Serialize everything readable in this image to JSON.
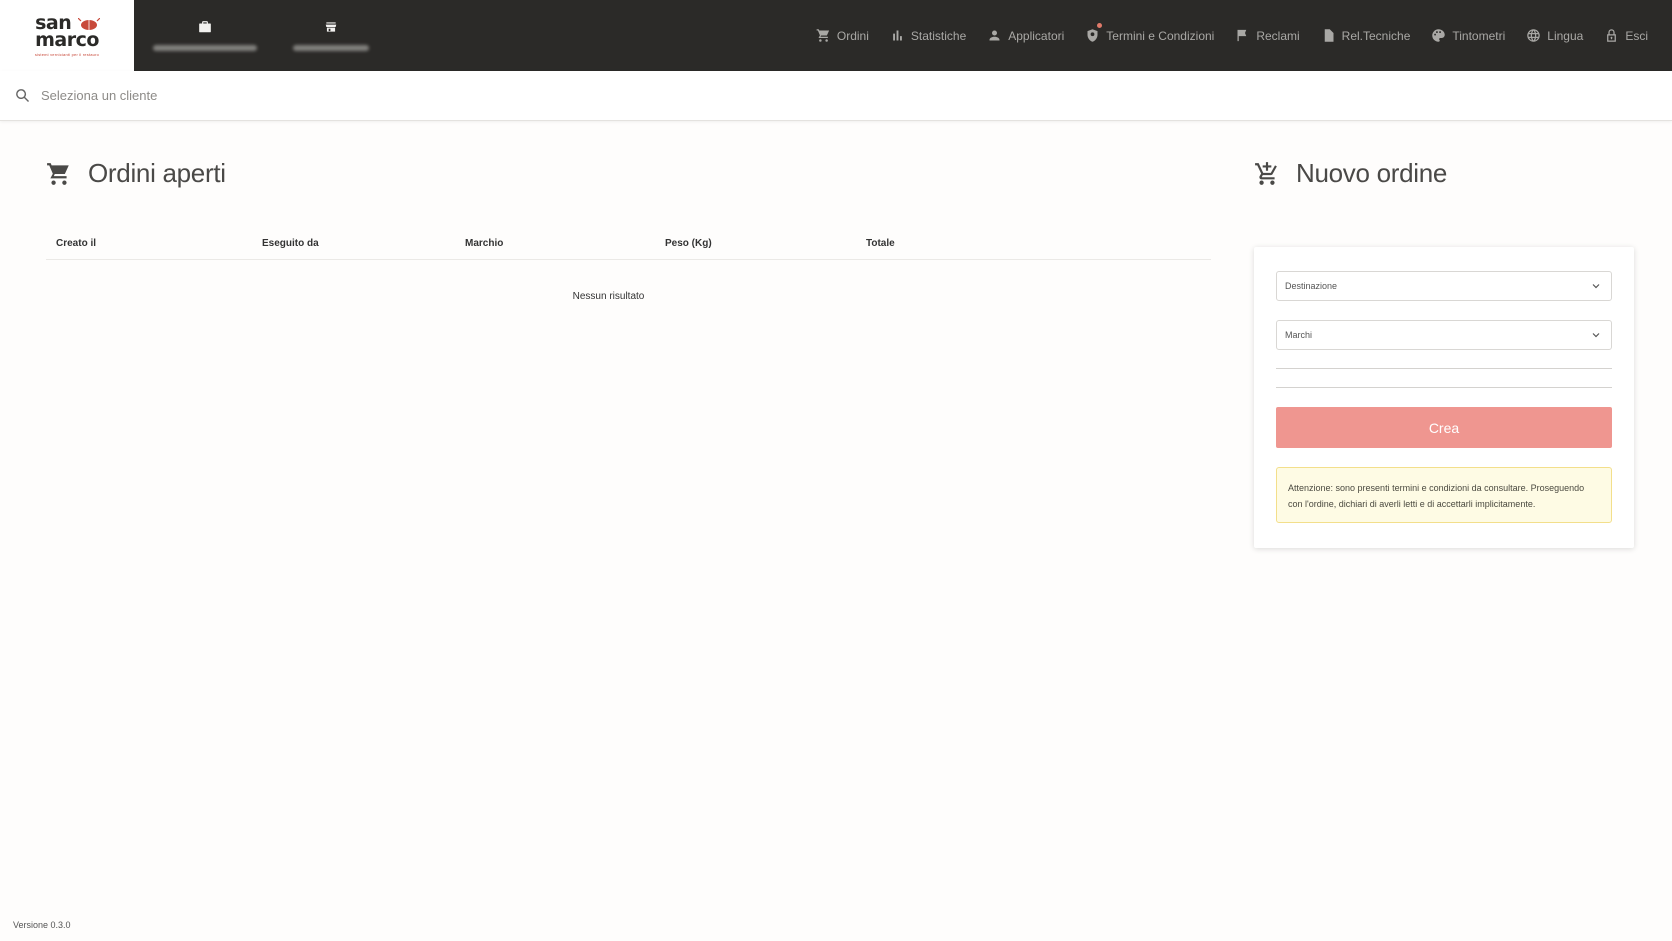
{
  "brand": {
    "line1": "san",
    "line2": "marco",
    "tagline": "sistemi vernicianti per il restauro"
  },
  "topnav": {
    "left": [
      {
        "icon": "briefcase-icon"
      },
      {
        "icon": "store-icon"
      }
    ],
    "right": [
      {
        "icon": "cart-icon",
        "label": "Ordini"
      },
      {
        "icon": "bar-chart-icon",
        "label": "Statistiche"
      },
      {
        "icon": "person-icon",
        "label": "Applicatori"
      },
      {
        "icon": "terms-badge-icon",
        "label": "Termini e Condizioni"
      },
      {
        "icon": "flag-icon",
        "label": "Reclami"
      },
      {
        "icon": "document-icon",
        "label": "Rel.Tecniche"
      },
      {
        "icon": "palette-icon",
        "label": "Tintometri"
      },
      {
        "icon": "globe-icon",
        "label": "Lingua"
      },
      {
        "icon": "lock-icon",
        "label": "Esci"
      }
    ]
  },
  "search": {
    "placeholder": "Seleziona un cliente"
  },
  "open_orders": {
    "title": "Ordini aperti",
    "columns": [
      "Creato il",
      "Eseguito da",
      "Marchio",
      "Peso (Kg)",
      "Totale"
    ],
    "empty_text": "Nessun risultato"
  },
  "new_order": {
    "title": "Nuovo ordine",
    "destination_label": "Destinazione",
    "brands_label": "Marchi",
    "create_label": "Crea",
    "warning_text": "Attenzione: sono presenti termini e condizioni da consultare. Proseguendo con l'ordine, dichiari di averli letti e di accettarli implicitamente."
  },
  "version": "Versione 0.3.0",
  "colors": {
    "topbar": "#2b2a28",
    "accent": "#ef9690",
    "warning_bg": "#fefbe4",
    "warning_border": "#f3df8b"
  }
}
